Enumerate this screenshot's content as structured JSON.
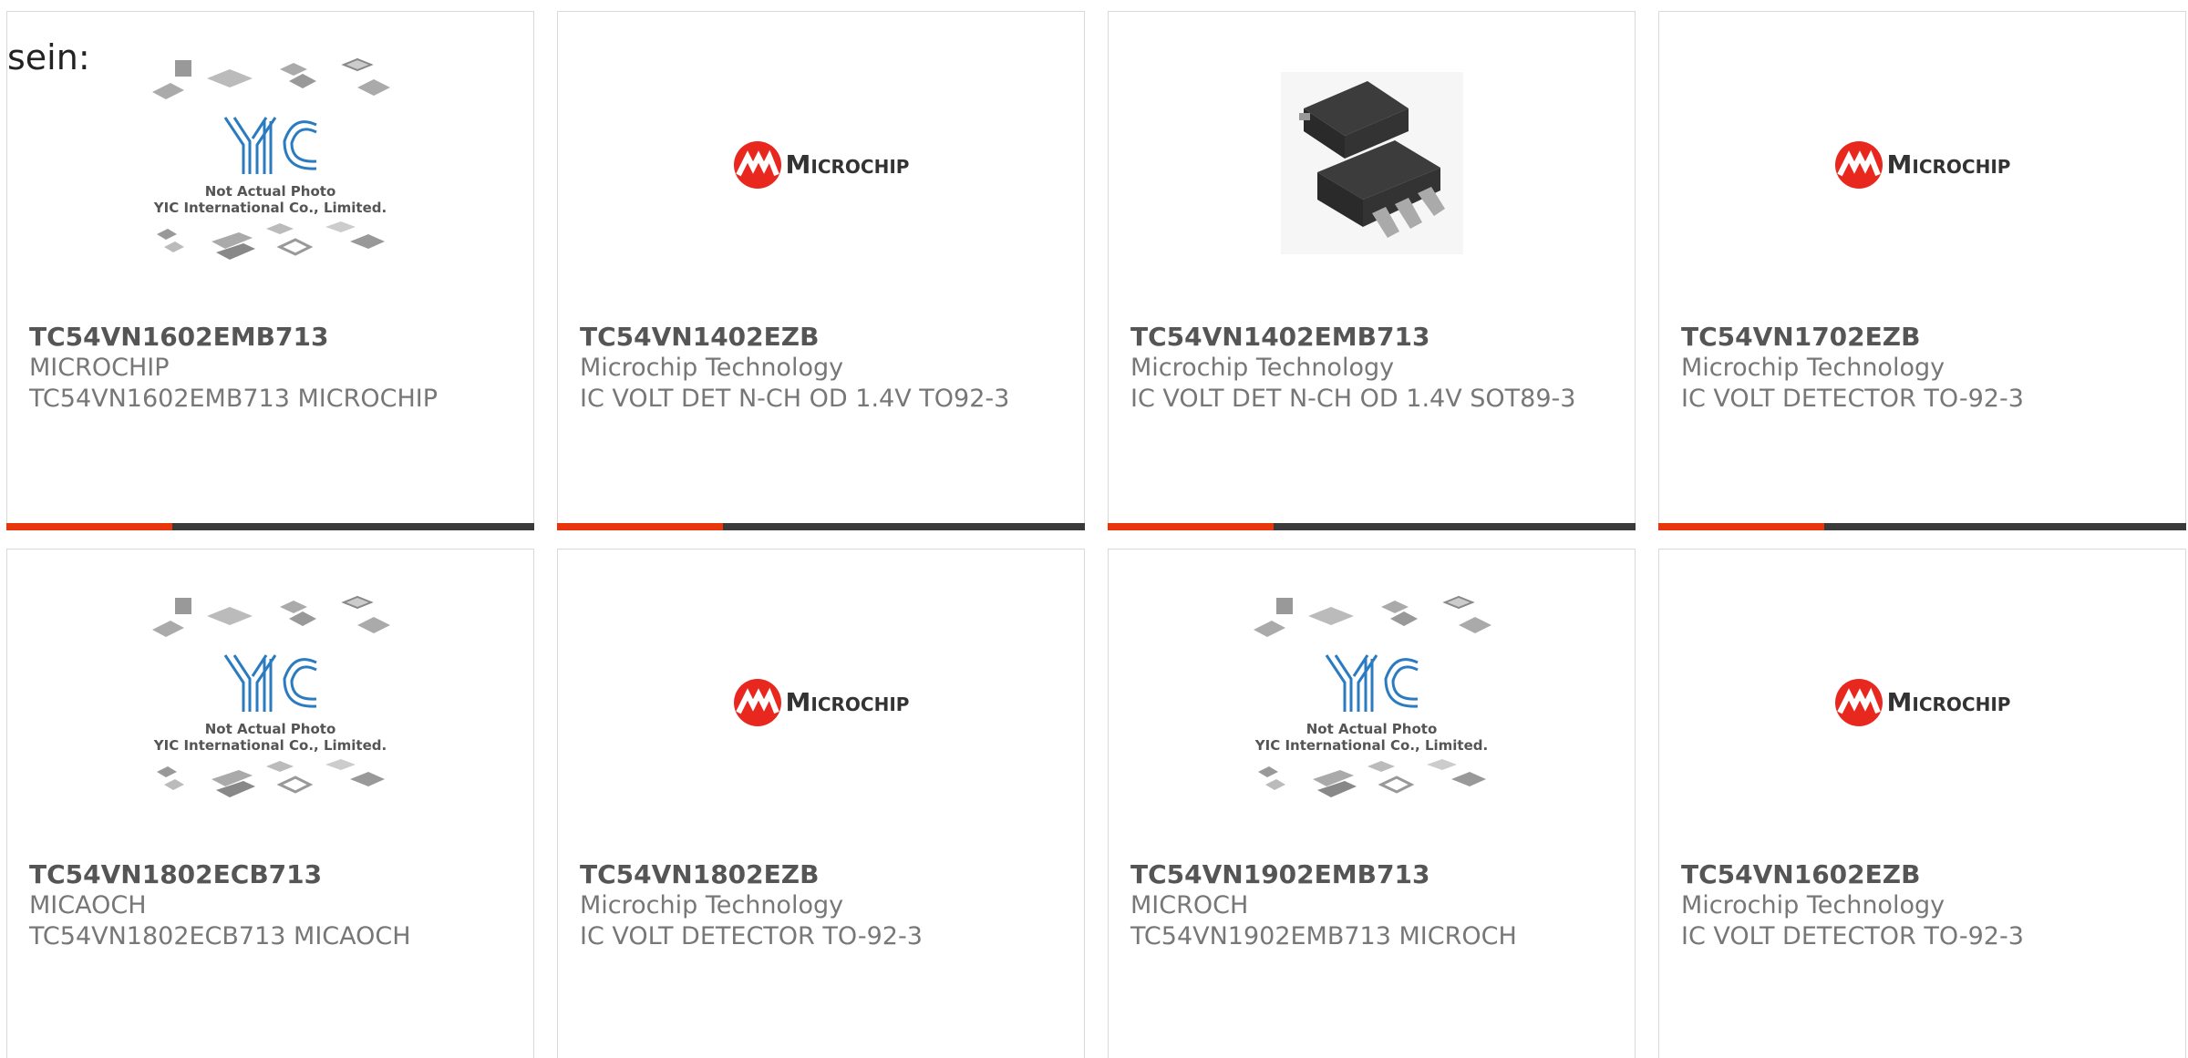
{
  "header_fragment": "sein:",
  "brand_colors": {
    "accent": "#e8350c",
    "bar": "#3a3a3a",
    "microchip_red": "#e8271e",
    "yic_blue": "#2a7bc0"
  },
  "placeholder_image": {
    "line1": "Not Actual Photo",
    "line2": "YIC International Co., Limited.",
    "logo_text": "YIC"
  },
  "microchip_logo_text": "Microchip",
  "products": [
    {
      "part": "TC54VN1602EMB713",
      "maker": "MICROCHIP",
      "desc": "TC54VN1602EMB713 MICROCHIP",
      "image": "yic-placeholder"
    },
    {
      "part": "TC54VN1402EZB",
      "maker": "Microchip Technology",
      "desc": "IC VOLT DET N-CH OD 1.4V TO92-3",
      "image": "microchip-logo"
    },
    {
      "part": "TC54VN1402EMB713",
      "maker": "Microchip Technology",
      "desc": "IC VOLT DET N-CH OD 1.4V SOT89-3",
      "image": "sot89-package"
    },
    {
      "part": "TC54VN1702EZB",
      "maker": "Microchip Technology",
      "desc": "IC VOLT DETECTOR TO-92-3",
      "image": "microchip-logo"
    },
    {
      "part": "TC54VN1802ECB713",
      "maker": "MICAOCH",
      "desc": "TC54VN1802ECB713 MICAOCH",
      "image": "yic-placeholder"
    },
    {
      "part": "TC54VN1802EZB",
      "maker": "Microchip Technology",
      "desc": "IC VOLT DETECTOR TO-92-3",
      "image": "microchip-logo"
    },
    {
      "part": "TC54VN1902EMB713",
      "maker": "MICROCH",
      "desc": "TC54VN1902EMB713 MICROCH",
      "image": "yic-placeholder"
    },
    {
      "part": "TC54VN1602EZB",
      "maker": "Microchip Technology",
      "desc": "IC VOLT DETECTOR TO-92-3",
      "image": "microchip-logo"
    }
  ]
}
